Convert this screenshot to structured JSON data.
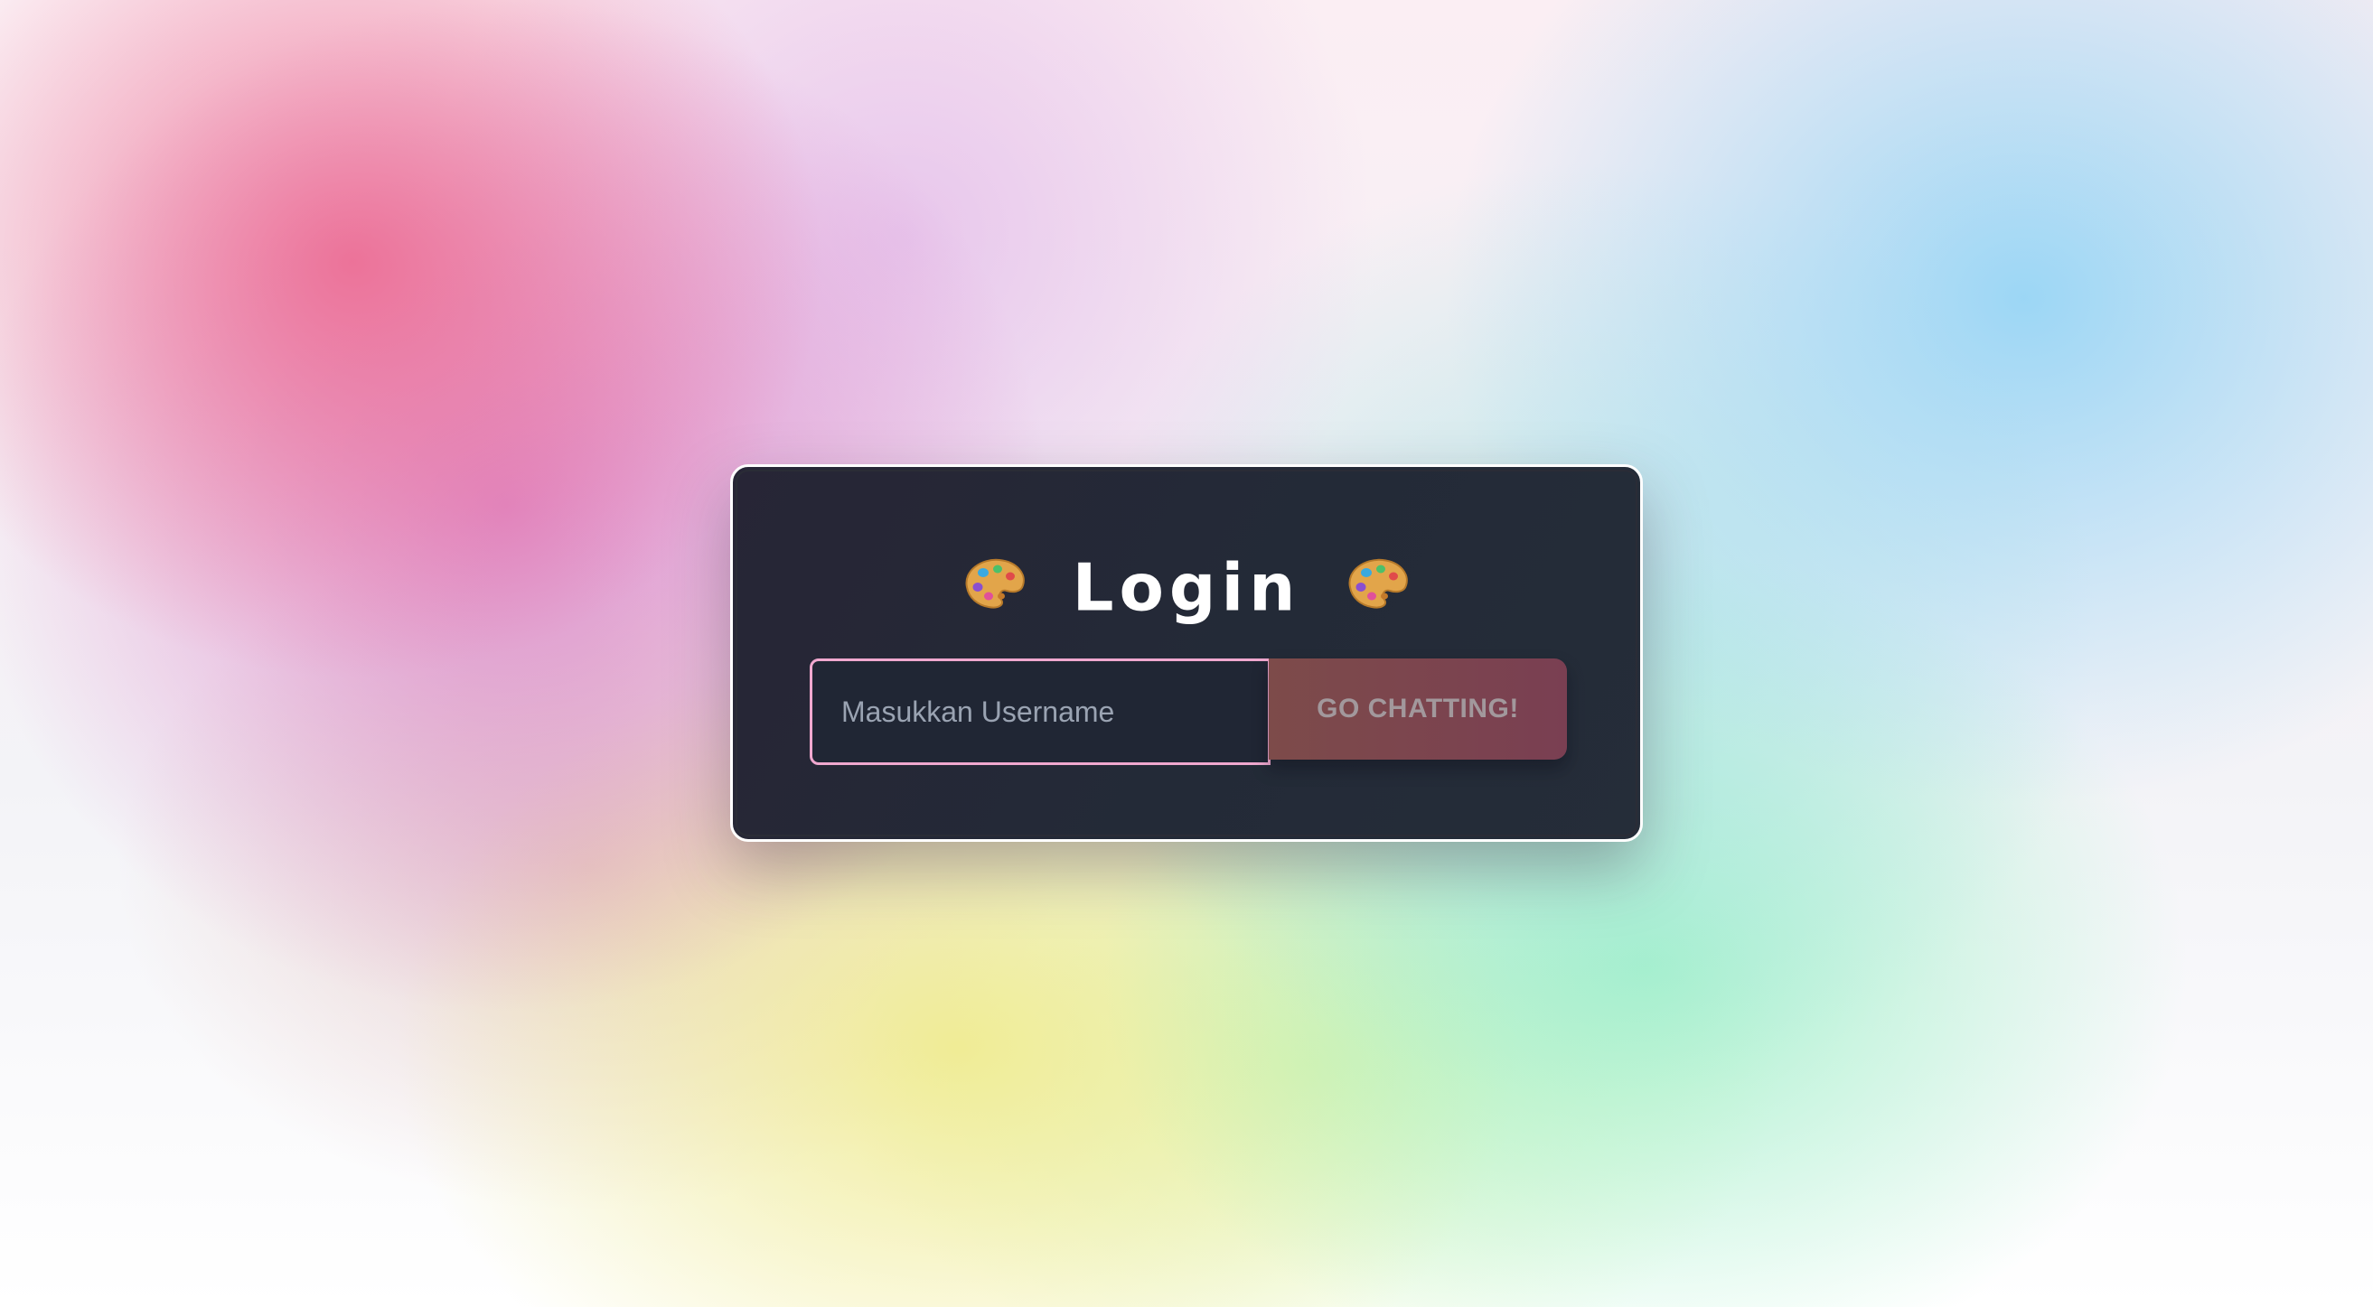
{
  "login": {
    "title": "Login",
    "left_icon": "artist-palette-icon",
    "right_icon": "artist-palette-icon",
    "username": {
      "value": "",
      "placeholder": "Masukkan Username"
    },
    "submit_label": "GO CHATTING!"
  },
  "colors": {
    "card_background": "#252a38",
    "input_border": "#f0a8cf",
    "button_start": "#7d4b4a",
    "button_end": "#7a3f52",
    "title_text": "#ffffff"
  }
}
